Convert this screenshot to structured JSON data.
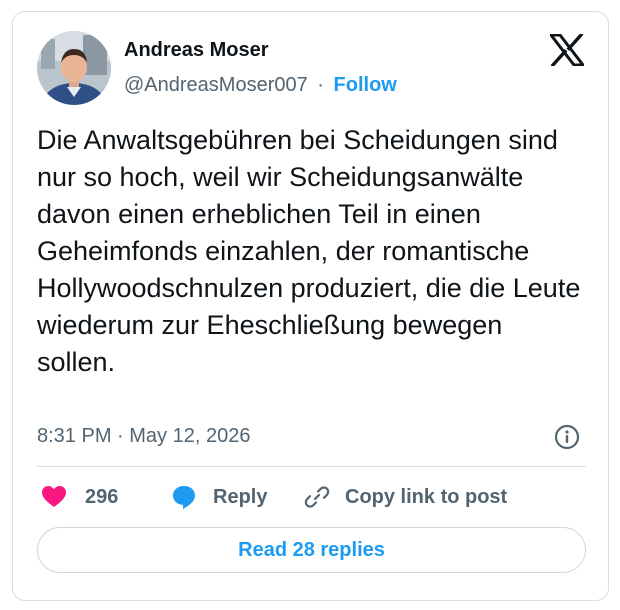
{
  "author": {
    "name": "Andreas Moser",
    "handle": "@AndreasMoser007",
    "separator": "·",
    "follow_label": "Follow"
  },
  "tweet": {
    "text": "Die Anwaltsgebühren bei Scheidungen sind nur so hoch, weil wir Scheidungsanwälte davon einen erheblichen Teil in einen Geheimfonds einzahlen, der romantische Hollywoodschnulzen produziert, die die Leute wiederum zur Eheschließung bewegen sollen.",
    "timestamp": "8:31 PM · May 12, 2026"
  },
  "actions": {
    "like_count": "296",
    "reply_label": "Reply",
    "copy_link_label": "Copy link to post"
  },
  "read_replies_label": "Read 28 replies",
  "icons": [
    "x-logo-icon",
    "info-icon",
    "heart-icon",
    "reply-bubble-icon",
    "link-icon"
  ],
  "colors": {
    "accent": "#1d9bf0",
    "like": "#f91880",
    "text": "#0f1419",
    "muted": "#536471",
    "border": "#d6dde3"
  }
}
